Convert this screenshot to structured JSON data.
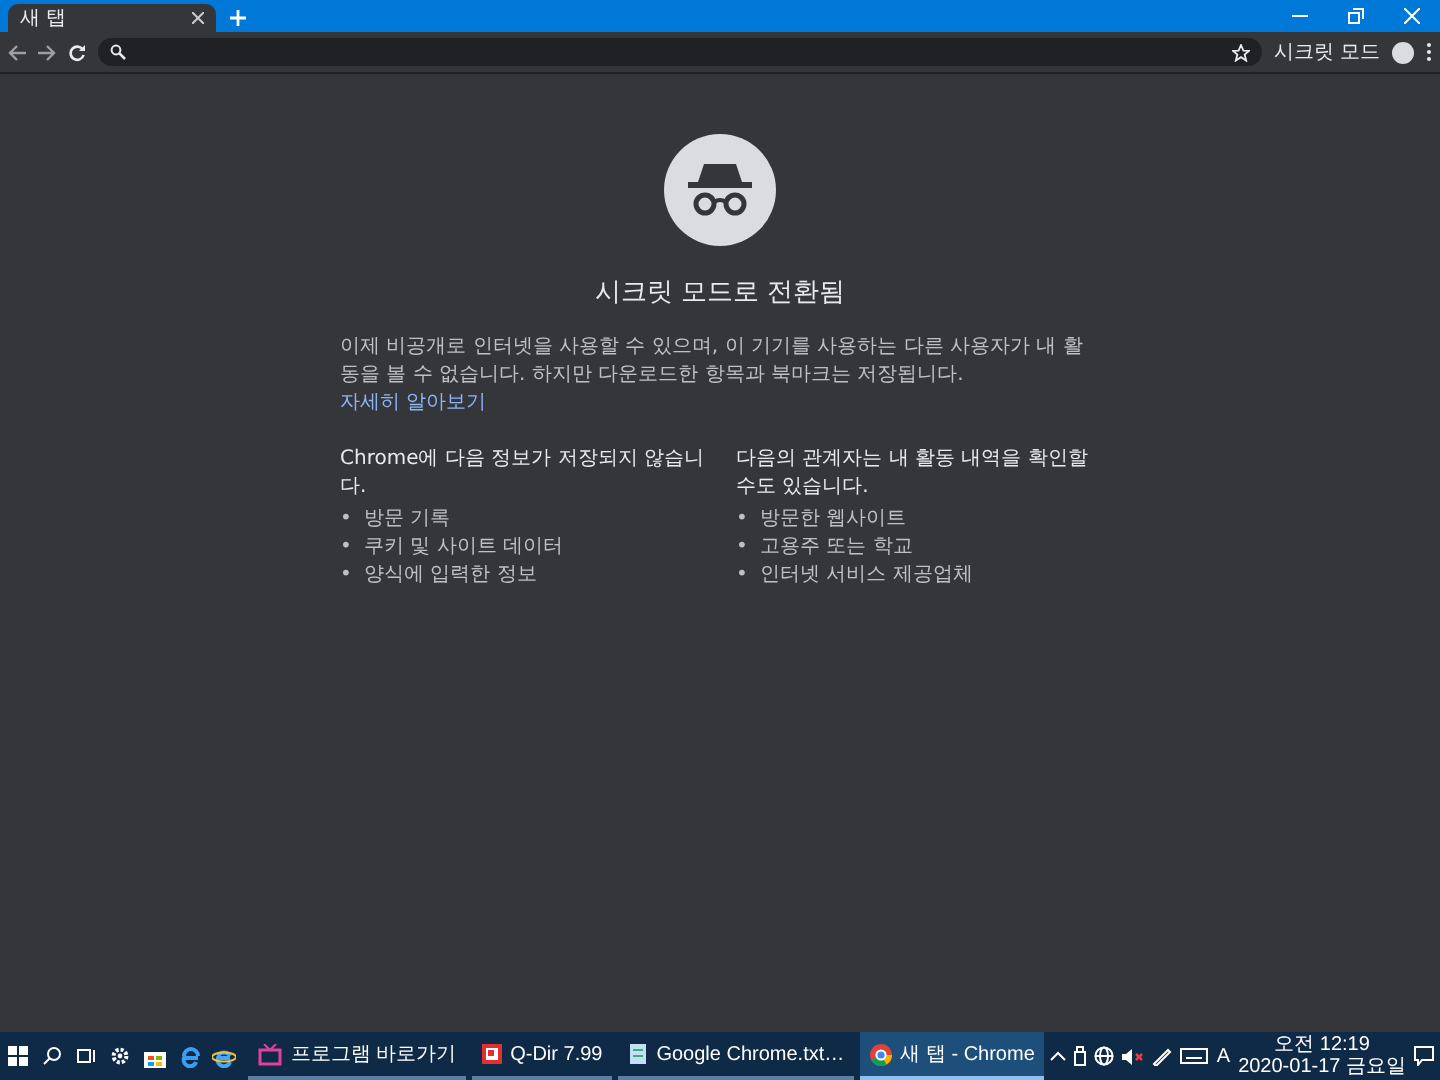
{
  "tabs": [
    {
      "label": "새 탭",
      "selected": true
    }
  ],
  "toolbar": {
    "profile_label": "시크릿 모드"
  },
  "content": {
    "title": "시크릿 모드로 전환됨",
    "intro": "이제 비공개로 인터넷을 사용할 수 있으며, 이 기기를 사용하는 다른 사용자가 내 활동을 볼 수 없습니다. 하지만 다운로드한 항목과 북마크는 저장됩니다.",
    "learn_more": "자세히 알아보기",
    "columns": [
      {
        "heading": "Chrome에 다음 정보가 저장되지 않습니다.",
        "items": [
          {
            "bullet": "•",
            "text": "방문 기록"
          },
          {
            "bullet": "•",
            "text": "쿠키 및 사이트 데이터"
          },
          {
            "bullet": "•",
            "text": "양식에 입력한 정보"
          }
        ]
      },
      {
        "heading": "다음의 관계자는 내 활동 내역을 확인할 수도 있습니다.",
        "items": [
          {
            "bullet": "•",
            "text": "방문한 웹사이트"
          },
          {
            "bullet": "•",
            "text": "고용주 또는 학교"
          },
          {
            "bullet": "•",
            "text": "인터넷 서비스 제공업체"
          }
        ]
      }
    ]
  },
  "taskbar": {
    "pinned": [
      {
        "kind": "start"
      },
      {
        "kind": "search"
      },
      {
        "kind": "taskview"
      },
      {
        "kind": "settings"
      },
      {
        "kind": "store"
      },
      {
        "kind": "edge"
      },
      {
        "kind": "ie"
      }
    ],
    "apps": [
      {
        "kind": "tv",
        "label": "프로그램 바로가기",
        "selected": false
      },
      {
        "kind": "qdir",
        "label": "Q-Dir 7.99",
        "selected": false
      },
      {
        "kind": "notepad",
        "label": "Google Chrome.txt…",
        "selected": false
      },
      {
        "kind": "chrome",
        "label": "새 탭 - Chrome",
        "selected": true
      }
    ],
    "ime": "A",
    "time": "오전 12:19",
    "date": "2020-01-17 금요일"
  }
}
